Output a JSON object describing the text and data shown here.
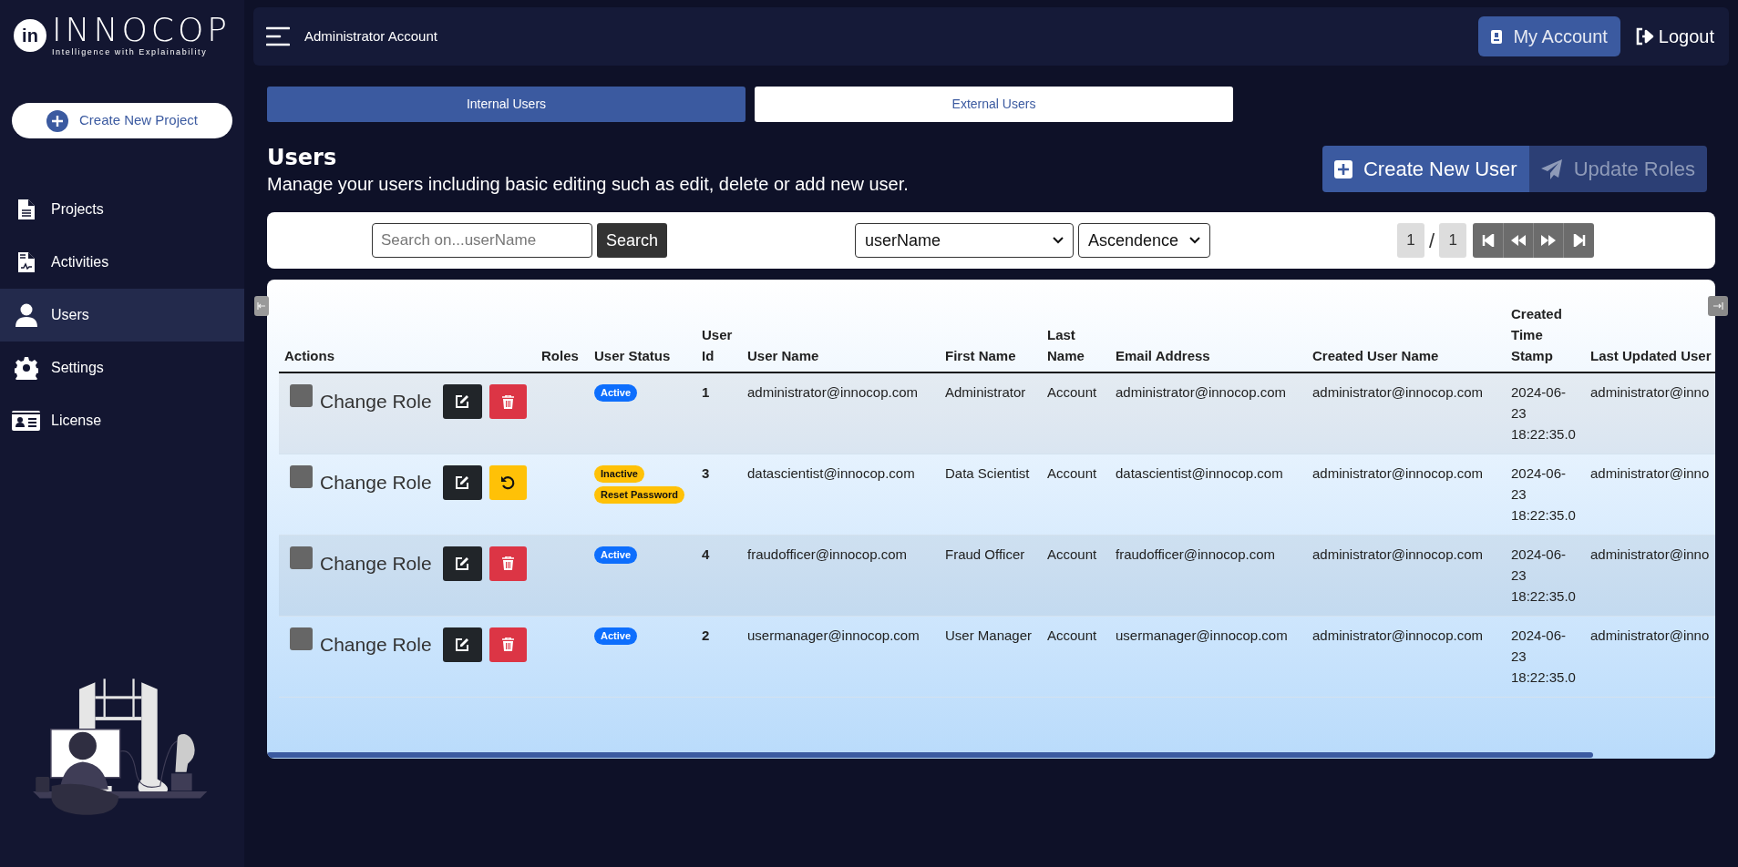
{
  "brand": {
    "mark": "in",
    "name": "INNOCOP",
    "tagline": "Intelligence with Explainability"
  },
  "sidebar": {
    "create_button": "Create New Project",
    "items": [
      {
        "label": "Projects",
        "selected": false
      },
      {
        "label": "Activities",
        "selected": false
      },
      {
        "label": "Users",
        "selected": true
      },
      {
        "label": "Settings",
        "selected": false
      },
      {
        "label": "License",
        "selected": false
      }
    ]
  },
  "header": {
    "title": "Administrator Account",
    "account_button": "My Account",
    "logout_button": "Logout"
  },
  "tabs": [
    {
      "label": "Internal Users",
      "selected": true
    },
    {
      "label": "External Users",
      "selected": false
    }
  ],
  "page": {
    "title": "Users",
    "subtitle": "Manage your users including basic editing such as edit, delete or add new user."
  },
  "actions": [
    {
      "label": "Create New User",
      "kind": "create",
      "disabled": false
    },
    {
      "label": "Update Roles",
      "kind": "send",
      "disabled": true
    }
  ],
  "filter": {
    "search_placeholder": "Search on...userName",
    "search_button": "Search",
    "sort_field": "userName",
    "sort_order": "Ascendence"
  },
  "pagination": {
    "page": "1",
    "separator": "/",
    "total": "1"
  },
  "table": {
    "columns": [
      "Actions",
      "Roles",
      "User Status",
      "User Id",
      "User Name",
      "First Name",
      "Last Name",
      "Email Address",
      "Created User Name",
      "Created Time Stamp",
      "Last Updated User"
    ],
    "rows": [
      {
        "checked": false,
        "kind": "delete",
        "cells": [
          "Change Role",
          "",
          [
            {
              "label": "Active",
              "kind": "primary"
            }
          ],
          "1",
          "administrator@innocop.com",
          "Administrator",
          "Account",
          "administrator@innocop.com",
          "administrator@innocop.com",
          "2024-06-23 18:22:35.0",
          "administrator@inno"
        ]
      },
      {
        "checked": false,
        "kind": "restore",
        "cells": [
          "Change Role",
          "",
          [
            {
              "label": "Inactive",
              "kind": "warning"
            },
            {
              "label": "Reset Password",
              "kind": "warning"
            }
          ],
          "3",
          "datascientist@innocop.com",
          "Data Scientist",
          "Account",
          "datascientist@innocop.com",
          "administrator@innocop.com",
          "2024-06-23 18:22:35.0",
          "administrator@inno"
        ]
      },
      {
        "checked": false,
        "kind": "delete",
        "cells": [
          "Change Role",
          "",
          [
            {
              "label": "Active",
              "kind": "primary"
            }
          ],
          "4",
          "fraudofficer@innocop.com",
          "Fraud Officer",
          "Account",
          "fraudofficer@innocop.com",
          "administrator@innocop.com",
          "2024-06-23 18:22:35.0",
          "administrator@inno"
        ]
      },
      {
        "checked": false,
        "kind": "delete",
        "cells": [
          "Change Role",
          "",
          [
            {
              "label": "Active",
              "kind": "primary"
            }
          ],
          "2",
          "usermanager@innocop.com",
          "User Manager",
          "Account",
          "usermanager@innocop.com",
          "administrator@innocop.com",
          "2024-06-23 18:22:35.0",
          "administrator@inno"
        ]
      }
    ]
  }
}
